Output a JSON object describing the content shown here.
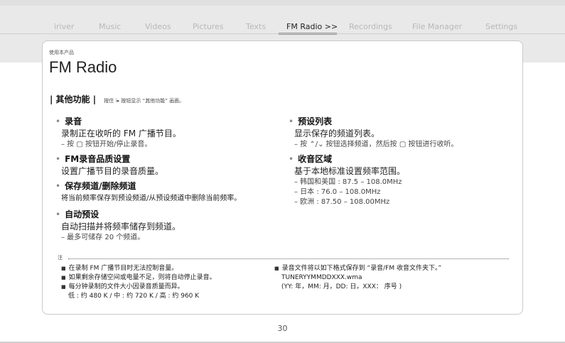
{
  "nav": {
    "items": [
      "iriver",
      "Music",
      "Videos",
      "Pictures",
      "Texts",
      "FM Radio >>",
      "Recordings",
      "File Manager",
      "Settings"
    ],
    "active_index": 5
  },
  "page": {
    "breadcrumb": "使用本产品",
    "title": "FM Radio",
    "section_title": "| 其他功能 |",
    "section_hint": "按住 ⁝▸ 按钮显示 “其他功能” 画面。"
  },
  "features_left": [
    {
      "heading": "录音",
      "lines": [
        {
          "text": "录制正在收听的 FM 广播节目。",
          "kind": "d"
        },
        {
          "text": "– 按 ▢ 按钮开始/停止录音。",
          "kind": "n"
        }
      ]
    },
    {
      "heading": "FM录音品质设置",
      "lines": [
        {
          "text": "设置广播节目的录音质量。",
          "kind": "d"
        }
      ]
    },
    {
      "heading": "保存频道/删除频道",
      "lines": [
        {
          "text": "将当前频率保存到预设频道/从预设频道中删除当前频率。",
          "kind": "s"
        }
      ]
    },
    {
      "heading": "自动预设",
      "lines": [
        {
          "text": "自动扫描并将频率储存到频道。",
          "kind": "d"
        },
        {
          "text": "– 最多可储存 20 个频道。",
          "kind": "n"
        }
      ]
    }
  ],
  "features_right": [
    {
      "heading": "预设列表",
      "lines": [
        {
          "text": "显示保存的频道列表。",
          "kind": "d"
        },
        {
          "text": "– 按 ⌃/⌄ 按钮选择频道，然后按 ▢ 按钮进行收听。",
          "kind": "n"
        }
      ]
    },
    {
      "heading": "收音区域",
      "lines": [
        {
          "text": "基于本地标准设置频率范围。",
          "kind": "d"
        },
        {
          "text": "– 韩国和美国 : 87.5 – 108.0MHz",
          "kind": "n"
        },
        {
          "text": "– 日本 :  76.0 – 108.0MHz",
          "kind": "n"
        },
        {
          "text": "– 欧洲 : 87.50 – 108.00MHz",
          "kind": "n"
        }
      ]
    }
  ],
  "notes": {
    "label": "注",
    "left": [
      {
        "text": "在录制 FM 广播节目时无法控制音量。"
      },
      {
        "text": "如果剩余存储空间或电量不足，则将自动停止录音。"
      },
      {
        "text": "每分钟录制的文件大小因录音质量而异。",
        "sub": "低 : 约 480 K / 中 : 约 720 K / 高 : 约 960 K"
      }
    ],
    "right": [
      {
        "text": "录音文件将以如下格式保存到 “录音/FM 收音文件夹下。”",
        "sub": "TUNERYYMMDDXXX.wma",
        "sub2": "(YY: 年，MM: 月，DD: 日，XXX：  序号 )"
      }
    ]
  },
  "page_number": "30"
}
